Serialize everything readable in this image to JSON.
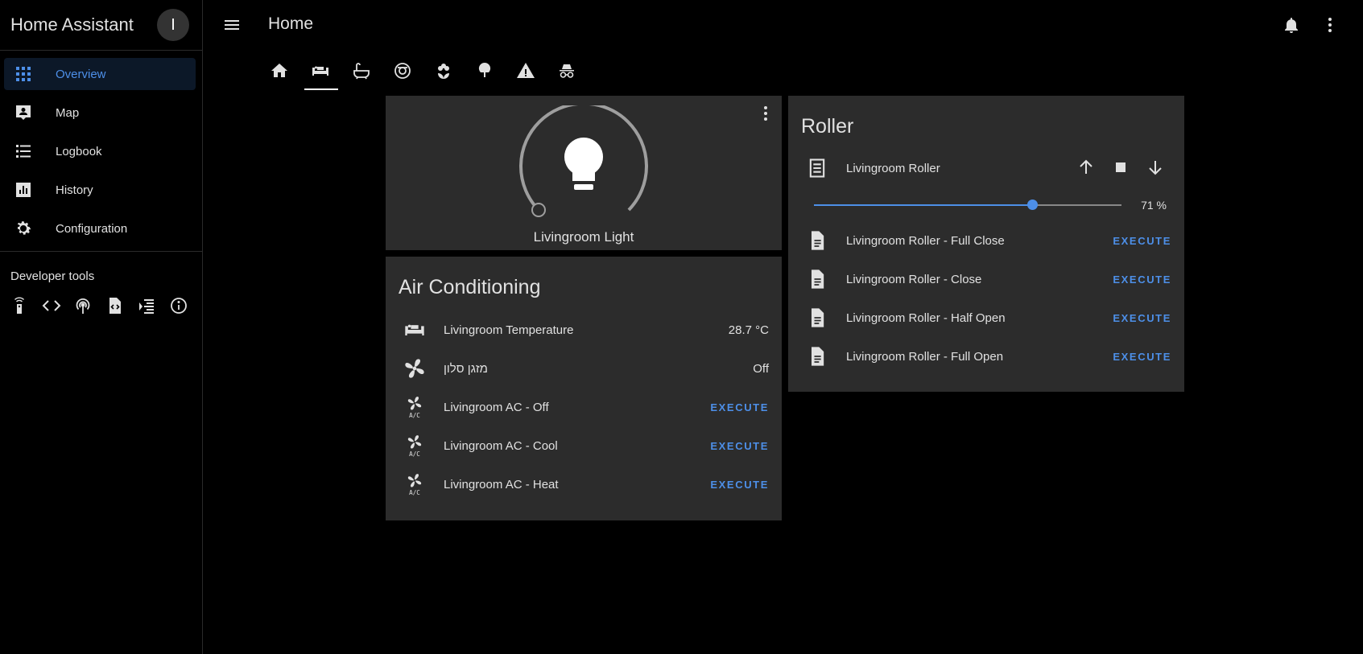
{
  "app": {
    "title": "Home Assistant",
    "avatar_initial": "I"
  },
  "sidebar": {
    "items": [
      {
        "label": "Overview",
        "icon": "view-dashboard-icon",
        "active": true
      },
      {
        "label": "Map",
        "icon": "map-account-icon"
      },
      {
        "label": "Logbook",
        "icon": "format-list-bulleted-icon"
      },
      {
        "label": "History",
        "icon": "chart-box-icon"
      },
      {
        "label": "Configuration",
        "icon": "cog-icon"
      }
    ],
    "developer_tools_label": "Developer tools",
    "developer_tools": [
      "remote-icon",
      "code-brackets-icon",
      "access-point-icon",
      "file-code-icon",
      "timer-text-icon",
      "information-outline-icon"
    ]
  },
  "header": {
    "title": "Home"
  },
  "tabs": [
    "home-icon",
    "sofa-icon",
    "bathtub-icon",
    "robot-vacuum-icon",
    "flower-icon",
    "tree-icon",
    "alert-icon",
    "incognito-icon"
  ],
  "light_card": {
    "name": "Livingroom Light"
  },
  "ac_card": {
    "title": "Air Conditioning",
    "rows": [
      {
        "icon": "sofa-icon",
        "label": "Livingroom Temperature",
        "value": "28.7 °C"
      },
      {
        "icon": "fan-icon",
        "label": "מזגן סלון",
        "value": "Off"
      },
      {
        "icon": "air-conditioner-icon",
        "label": "Livingroom AC - Off",
        "action": "EXECUTE"
      },
      {
        "icon": "air-conditioner-icon",
        "label": "Livingroom AC - Cool",
        "action": "EXECUTE"
      },
      {
        "icon": "air-conditioner-icon",
        "label": "Livingroom AC - Heat",
        "action": "EXECUTE"
      }
    ]
  },
  "roller_card": {
    "title": "Roller",
    "entity": {
      "icon": "window-shutter-icon",
      "label": "Livingroom Roller"
    },
    "position": 71,
    "position_text": "71 %",
    "scripts": [
      {
        "icon": "script-text-icon",
        "label": "Livingroom Roller - Full Close",
        "action": "EXECUTE"
      },
      {
        "icon": "script-text-icon",
        "label": "Livingroom Roller - Close",
        "action": "EXECUTE"
      },
      {
        "icon": "script-text-icon",
        "label": "Livingroom Roller - Half Open",
        "action": "EXECUTE"
      },
      {
        "icon": "script-text-icon",
        "label": "Livingroom Roller - Full Open",
        "action": "EXECUTE"
      }
    ]
  },
  "colors": {
    "accent": "#4d8fe8",
    "card": "#2c2c2c",
    "background": "#000000"
  }
}
